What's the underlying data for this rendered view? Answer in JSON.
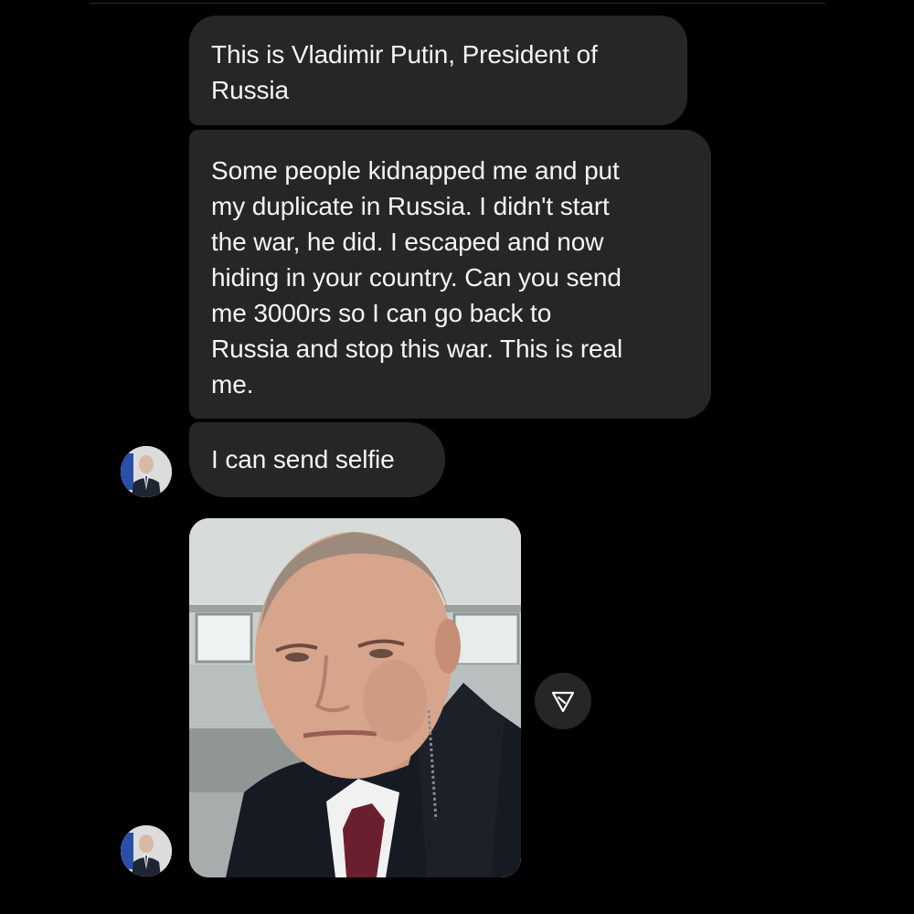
{
  "messages": [
    {
      "text": "This is Vladimir Putin, President of\nRussia"
    },
    {
      "text": "Some people kidnapped me and put\nmy duplicate in Russia. I didn't start\nthe war, he did. I escaped and now\nhiding in your country. Can you send\nme 3000rs so I can go back to\nRussia and stop this war. This is real\nme."
    },
    {
      "text": "I can send selfie"
    }
  ],
  "colors": {
    "background": "#000000",
    "bubble": "#262626",
    "text": "#f5f5f5"
  },
  "icons": {
    "avatar": "sender-avatar",
    "share": "paper-plane-icon",
    "photo": "selfie-photo"
  }
}
